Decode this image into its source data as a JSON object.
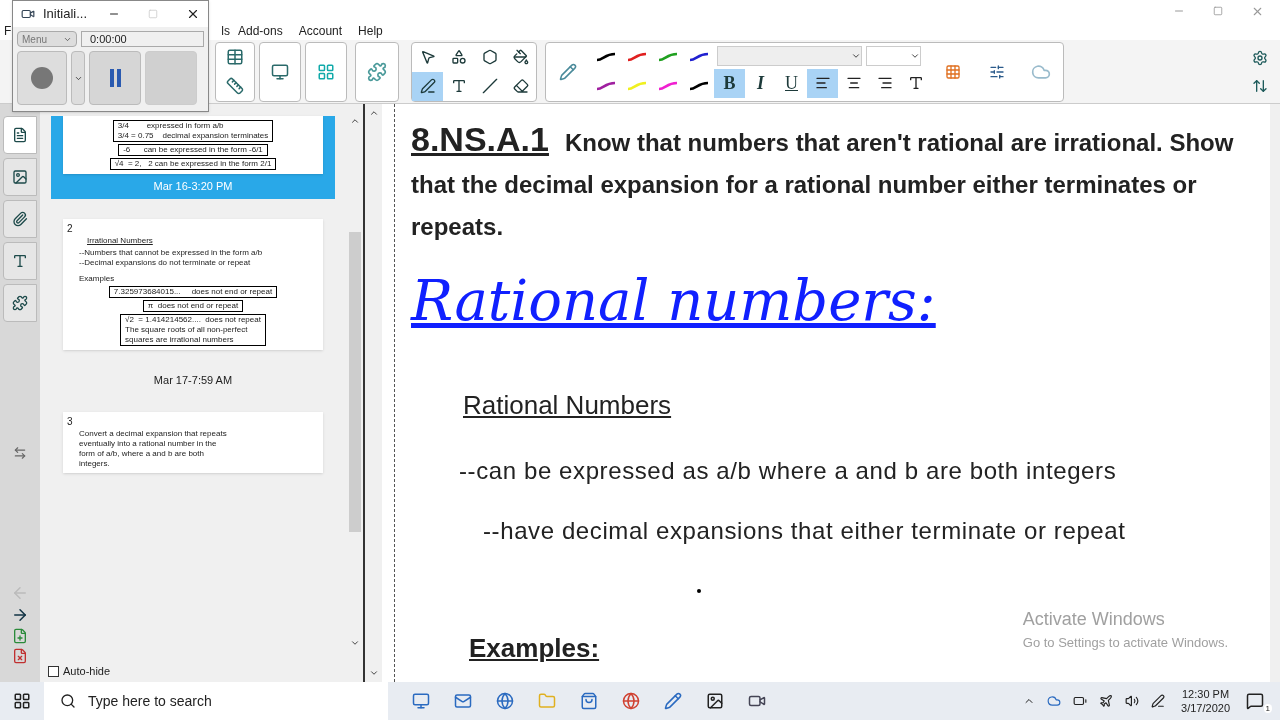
{
  "recorder": {
    "title": "Initiali...",
    "menu": "Menu",
    "time": "0:00:00"
  },
  "menu": [
    "F",
    "ls",
    "Add-ons",
    "Account",
    "Help"
  ],
  "toolbar": {
    "tools": [
      {
        "kind": "select",
        "selected": false
      },
      {
        "kind": "shapes",
        "selected": false
      },
      {
        "kind": "polygon",
        "selected": false
      },
      {
        "kind": "fill",
        "selected": false
      },
      {
        "kind": "pens",
        "selected": true
      },
      {
        "kind": "text",
        "selected": false
      },
      {
        "kind": "line",
        "selected": false
      },
      {
        "kind": "eraser",
        "selected": false
      }
    ],
    "pen_colors": [
      {
        "color": "#000000"
      },
      {
        "color": "#e02020"
      },
      {
        "color": "#20a020"
      },
      {
        "color": "#2020d0"
      },
      {
        "color": "#a020a0"
      },
      {
        "color": "#f0f020"
      },
      {
        "color": "#f020d0"
      },
      {
        "color": "#000000"
      }
    ],
    "format": [
      {
        "label": "B",
        "selected": true
      },
      {
        "label": "I",
        "selected": false
      },
      {
        "label": "U",
        "selected": false
      }
    ],
    "align": [
      {
        "kind": "left",
        "selected": true
      },
      {
        "kind": "center",
        "selected": false
      },
      {
        "kind": "right",
        "selected": false
      }
    ]
  },
  "side_tabs": [
    {
      "kind": "pages",
      "selected": true
    },
    {
      "kind": "gallery",
      "selected": false
    },
    {
      "kind": "attachments",
      "selected": false
    },
    {
      "kind": "properties",
      "selected": false
    },
    {
      "kind": "addons",
      "selected": false
    }
  ],
  "sorter": {
    "pages": [
      {
        "caption": "Mar 16-3:20 PM",
        "selected": true,
        "blocks": [
          {
            "kind": "box",
            "lines": [
              "3/4        expressed in form a/b",
              "3/4 = 0.75    decimal expansion terminates"
            ]
          },
          {
            "kind": "box",
            "lines": [
              "-6      can be expressed in the form -6/1"
            ]
          },
          {
            "kind": "box",
            "lines": [
              "√4  = 2,   2 can be expressed in the form 2/1"
            ]
          }
        ]
      },
      {
        "number": "2",
        "caption": "Mar 17-7:59 AM",
        "selected": false,
        "blocks": [
          {
            "kind": "heading",
            "lines": [
              "Irrational Numbers"
            ]
          },
          {
            "kind": "text",
            "lines": [
              "--Numbers that cannot be expressed in the form a/b",
              "--Decimal expansions do not terminate or repeat"
            ]
          },
          {
            "kind": "label",
            "lines": [
              "Examples"
            ]
          },
          {
            "kind": "box",
            "lines": [
              "7.325973684015...     does not end or repeat"
            ]
          },
          {
            "kind": "box",
            "lines": [
              "π  does not end or repeat"
            ]
          },
          {
            "kind": "box",
            "lines": [
              "√2  = 1.414214562....  does not repeat",
              "The square roots of all non-perfect",
              "squares are irrational numbers"
            ]
          }
        ]
      },
      {
        "number": "3",
        "selected": false,
        "blocks": [
          {
            "kind": "text",
            "lines": [
              "Convert a decimal expansion that repeats",
              "eventually into a rational number in the",
              "form of a/b, where a and b are both",
              "integers."
            ]
          }
        ]
      }
    ],
    "auto_hide": {
      "label": "Auto-hide",
      "checked": false
    }
  },
  "canvas": {
    "standard_code": "8.NS.A.1",
    "standard_text": "Know that numbers that aren't rational are irrational.  Show that the decimal expansion for a rational number either terminates or repeats.",
    "handwritten_title": "Rational numbers:",
    "heading": "Rational Numbers",
    "points": [
      "--can be expressed as a/b where a and b are both integers",
      "--have decimal expansions that either terminate or repeat"
    ],
    "examples_heading": "Examples:"
  },
  "activation_notice": {
    "title": "Activate Windows",
    "text": "Go to Settings to activate Windows."
  },
  "taskbar": {
    "search_placeholder": "Type here to search",
    "time": "12:30 PM",
    "date": "3/17/2020",
    "notification_count": "1"
  }
}
